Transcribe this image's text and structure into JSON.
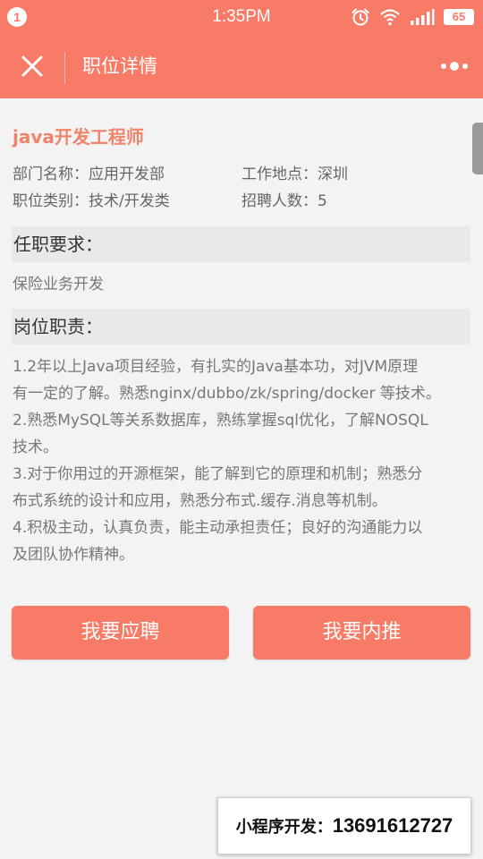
{
  "status_bar": {
    "notification_count": "1",
    "time": "1:35PM",
    "battery": "65",
    "icons": [
      "alarm-icon",
      "wifi-icon",
      "signal-icon",
      "battery-icon"
    ]
  },
  "app_bar": {
    "title": "职位详情",
    "close_icon": "close-icon",
    "more_icon": "more-dots-icon"
  },
  "job": {
    "title": "java开发工程师",
    "department": "部门名称：应用开发部",
    "location": "工作地点：深圳",
    "category": "职位类别：技术/开发类",
    "headcount": "招聘人数：5"
  },
  "requirements": {
    "heading": "任职要求：",
    "text": "保险业务开发"
  },
  "duties": {
    "heading": "岗位职责：",
    "lines": [
      "1.2年以上Java项目经验，有扎实的Java基本功，对JVM原理",
      "有一定的了解。熟悉nginx/dubbo/zk/spring/docker 等技术。",
      "2.熟悉MySQL等关系数据库，熟练掌握sql优化，了解NOSQL",
      "技术。",
      "3.对于你用过的开源框架，能了解到它的原理和机制；熟悉分",
      "布式系统的设计和应用，熟悉分布式.缓存.消息等机制。",
      "4.积极主动，认真负责，能主动承担责任；良好的沟通能力以",
      "及团队协作精神。"
    ]
  },
  "actions": {
    "apply_label": "我要应聘",
    "refer_label": "我要内推"
  },
  "watermark": {
    "label": "小程序开发：",
    "phone": "13691612727"
  },
  "colors": {
    "accent": "#f77b66",
    "title_text": "#f0836a",
    "section_bg": "#e9e9e9",
    "page_bg": "#f3f3f3"
  }
}
